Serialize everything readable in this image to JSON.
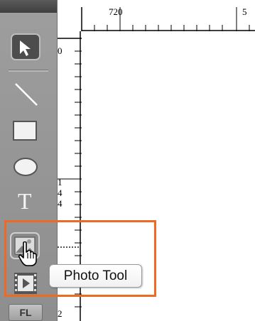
{
  "toolbar": {
    "tools": [
      {
        "name": "select",
        "icon": "arrow-select-icon",
        "active": true
      },
      {
        "name": "line",
        "icon": "line-icon"
      },
      {
        "name": "rectangle",
        "icon": "rectangle-icon"
      },
      {
        "name": "ellipse",
        "icon": "ellipse-icon"
      },
      {
        "name": "text",
        "icon": "text-icon"
      },
      {
        "name": "photo",
        "icon": "photo-icon",
        "hovered": true
      },
      {
        "name": "video",
        "icon": "film-icon"
      },
      {
        "name": "flash",
        "icon": "flash-icon",
        "label": "FL"
      }
    ]
  },
  "ruler": {
    "top_label": "720",
    "top_label_cut": "5",
    "left_labels": [
      "0",
      "1",
      "4",
      "4",
      "2"
    ]
  },
  "tooltip": {
    "text": "Photo Tool"
  },
  "colors": {
    "highlight": "#ee6a22",
    "toolbar_bg": "#969696"
  }
}
